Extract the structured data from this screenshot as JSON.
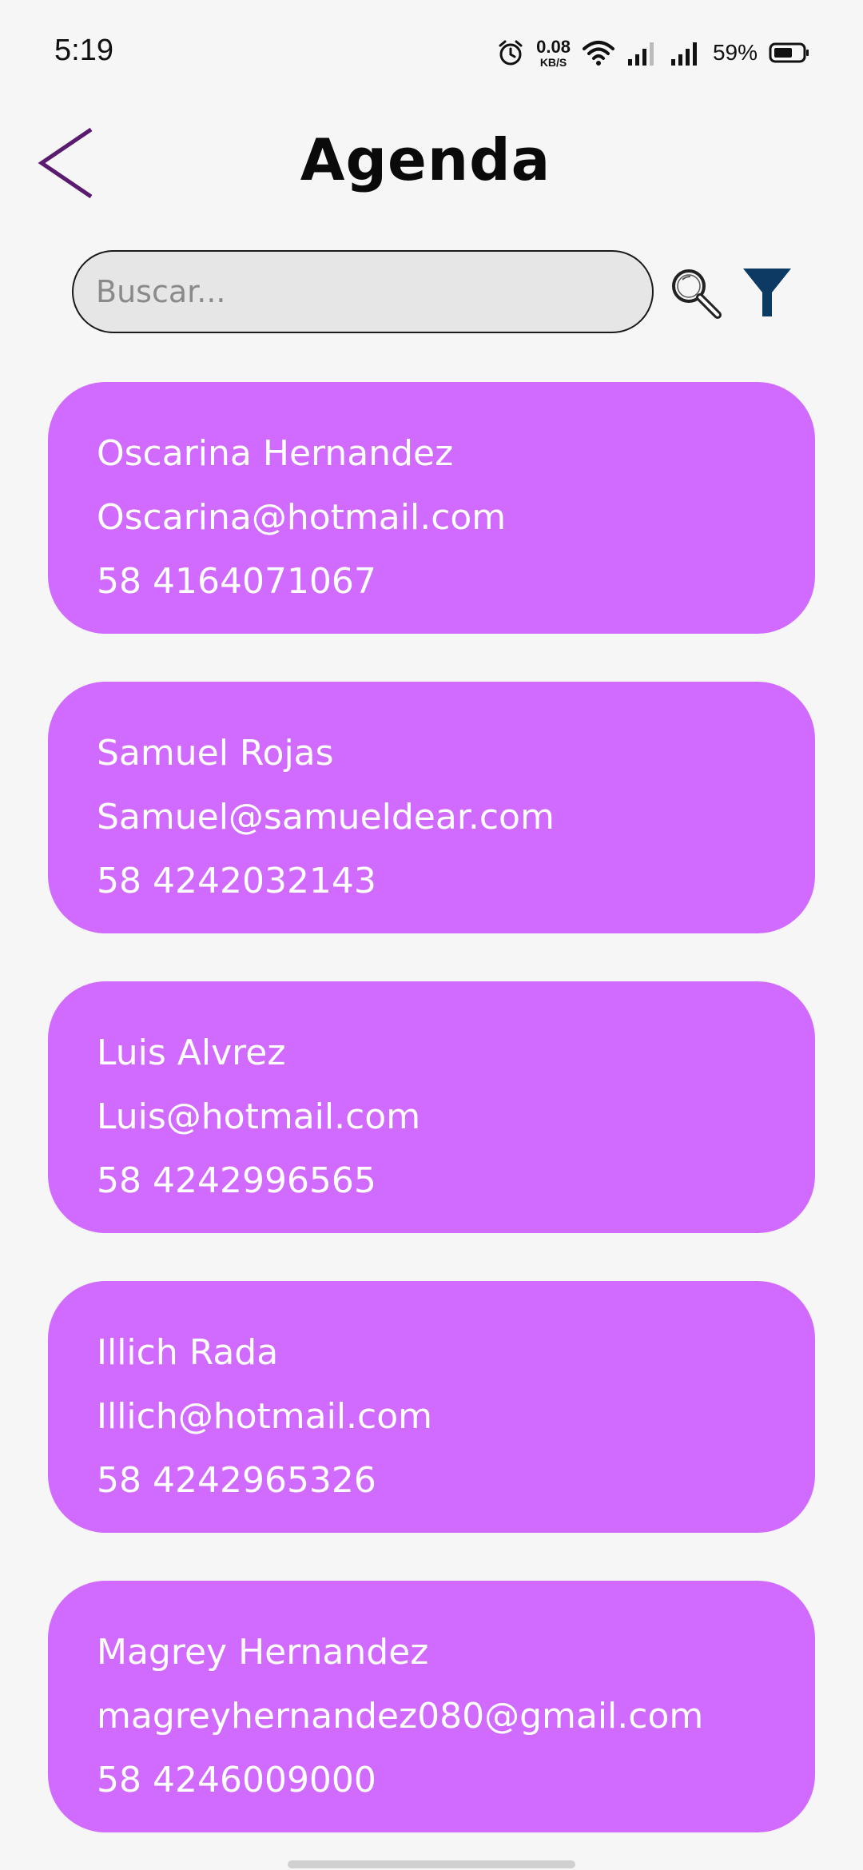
{
  "status_bar": {
    "time": "5:19",
    "net_speed_value": "0.08",
    "net_speed_unit": "KB/S",
    "battery_percent": "59%"
  },
  "header": {
    "title": "Agenda"
  },
  "search": {
    "placeholder": "Buscar..."
  },
  "contacts": [
    {
      "name": "Oscarina Hernandez",
      "email": "Oscarina@hotmail.com",
      "phone": "58 4164071067"
    },
    {
      "name": "Samuel Rojas",
      "email": "Samuel@samueldear.com",
      "phone": "58 4242032143"
    },
    {
      "name": "Luis Alvrez",
      "email": "Luis@hotmail.com",
      "phone": "58 4242996565"
    },
    {
      "name": "Illich Rada",
      "email": "Illich@hotmail.com",
      "phone": "58 4242965326"
    },
    {
      "name": "Magrey Hernandez",
      "email": "magreyhernandez080@gmail.com",
      "phone": "58 4246009000"
    }
  ],
  "colors": {
    "card_background": "#d16bff",
    "back_arrow": "#5a1a6e",
    "filter_icon": "#0d3a63",
    "page_background": "#f6f6f6"
  },
  "icons": {
    "back": "chevron-left-icon",
    "search": "search-icon",
    "filter": "filter-icon",
    "alarm": "alarm-icon",
    "wifi": "wifi-icon",
    "signal": "signal-icon",
    "battery": "battery-icon"
  }
}
